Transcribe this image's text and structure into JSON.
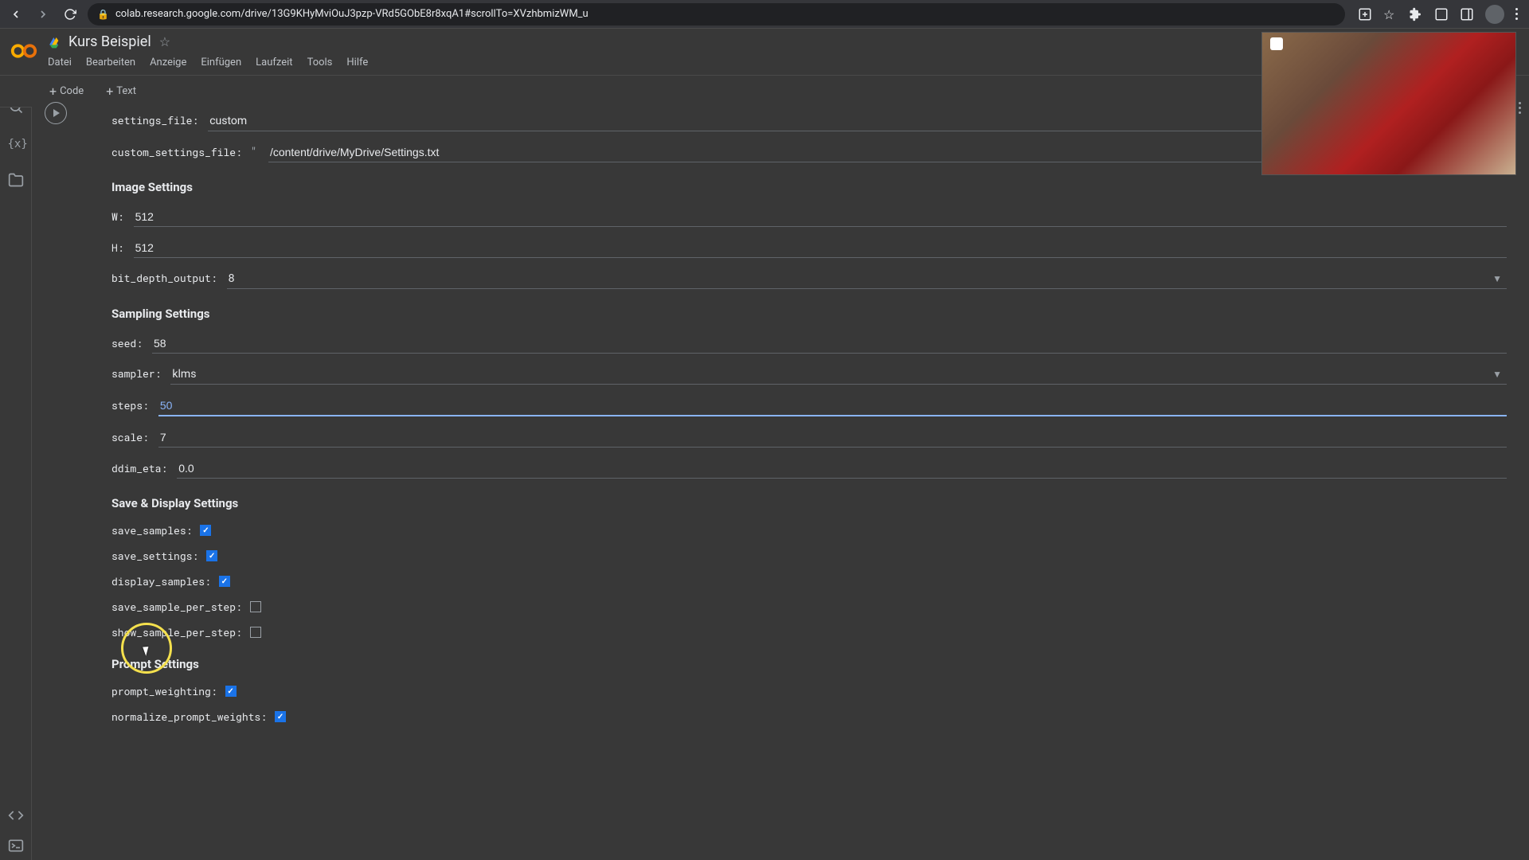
{
  "browser": {
    "url": "colab.research.google.com/drive/13G9KHyMviOuJ3pzp-VRd5GObE8r8xqA1#scrollTo=XVzhbmizWM_u"
  },
  "doc": {
    "title": "Kurs Beispiel"
  },
  "menubar": {
    "file": "Datei",
    "edit": "Bearbeiten",
    "view": "Anzeige",
    "insert": "Einfügen",
    "runtime": "Laufzeit",
    "tools": "Tools",
    "help": "Hilfe"
  },
  "toolbar": {
    "code": "Code",
    "text": "Text"
  },
  "form": {
    "settings_file": {
      "label": "settings_file:",
      "value": "custom"
    },
    "custom_settings_file": {
      "label": "custom_settings_file:",
      "quote": "\"",
      "value": "/content/drive/MyDrive/Settings.txt"
    },
    "image_heading": "Image Settings",
    "w": {
      "label": "W:",
      "value": "512"
    },
    "h": {
      "label": "H:",
      "value": "512"
    },
    "bit_depth_output": {
      "label": "bit_depth_output:",
      "value": "8"
    },
    "sampling_heading": "Sampling Settings",
    "seed": {
      "label": "seed:",
      "value": "58"
    },
    "sampler": {
      "label": "sampler:",
      "value": "klms"
    },
    "steps": {
      "label": "steps:",
      "value": "50"
    },
    "scale": {
      "label": "scale:",
      "value": "7"
    },
    "ddim_eta": {
      "label": "ddim_eta:",
      "value": "0.0"
    },
    "save_heading": "Save & Display Settings",
    "save_samples": {
      "label": "save_samples:",
      "checked": true
    },
    "save_settings": {
      "label": "save_settings:",
      "checked": true
    },
    "display_samples": {
      "label": "display_samples:",
      "checked": true
    },
    "save_sample_per_step": {
      "label": "save_sample_per_step:",
      "checked": false
    },
    "show_sample_per_step": {
      "label": "show_sample_per_step:",
      "checked": false
    },
    "prompt_heading": "Prompt Settings",
    "prompt_weighting": {
      "label": "prompt_weighting:",
      "checked": true
    },
    "normalize_prompt_weights": {
      "label": "normalize_prompt_weights:",
      "checked": true
    }
  }
}
